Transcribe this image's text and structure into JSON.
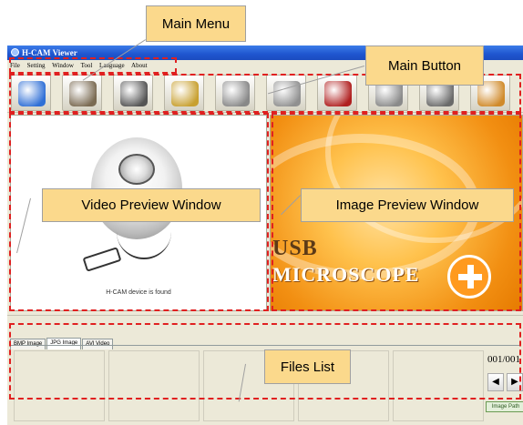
{
  "window": {
    "title": "H-CAM Viewer",
    "menu": [
      "File",
      "Setting",
      "Window",
      "Tool",
      "Language",
      "About"
    ]
  },
  "toolbar": {
    "buttons": [
      {
        "icon": "video-camera-icon",
        "color": "#2f6fd6"
      },
      {
        "icon": "photo-camera-icon",
        "color": "#7a6a52"
      },
      {
        "icon": "film-clapper-icon",
        "color": "#555555"
      },
      {
        "icon": "brush-paint-icon",
        "color": "#c8a030"
      },
      {
        "icon": "recycle-bin-icon",
        "color": "#888888"
      },
      {
        "icon": "projector-icon",
        "color": "#909090"
      },
      {
        "icon": "film-reel-icon",
        "color": "#b02020"
      },
      {
        "icon": "monitor-icon",
        "color": "#8a8a8a"
      },
      {
        "icon": "printer-icon",
        "color": "#6a6a6a"
      },
      {
        "icon": "exit-door-icon",
        "color": "#d08a2a"
      }
    ]
  },
  "video_preview": {
    "status": "H-CAM device is found"
  },
  "image_preview": {
    "brand_line1": "USB",
    "brand_line2": "MICROSCOPE"
  },
  "files": {
    "tabs": [
      "BMP Image",
      "JPG Image",
      "AVI Video"
    ],
    "active_tab": "JPG Image",
    "page_counter": "001/001",
    "prev_label": "◀",
    "next_label": "▶",
    "image_path_label": "Image Path"
  },
  "annotations": {
    "main_menu": "Main Menu",
    "main_button": "Main Button",
    "video_preview": "Video Preview Window",
    "image_preview": "Image Preview Window",
    "files_list": "Files List",
    "outline_color": "#e02020",
    "callout_color": "#fbd98c"
  }
}
